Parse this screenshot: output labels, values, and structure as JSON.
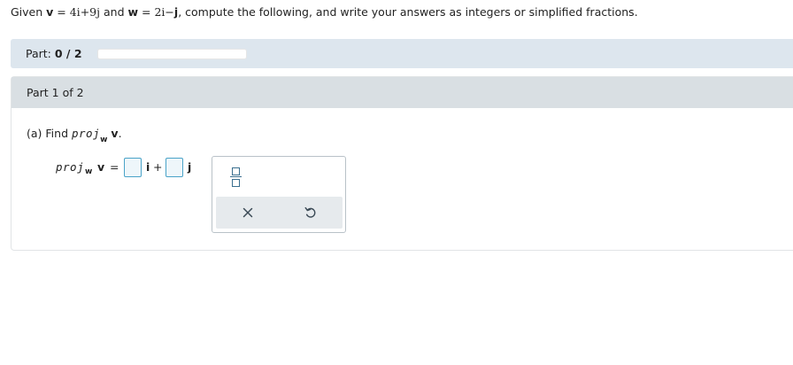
{
  "question": {
    "prefix": "Given ",
    "v_name": "v",
    "eq1": " = ",
    "v_expr_1": "4i",
    "v_plus": "+",
    "v_expr_2": "9j",
    "and": " and ",
    "w_name": "w",
    "eq2": " = ",
    "w_expr_1": "2i",
    "w_minus": "−",
    "w_expr_2": "j",
    "suffix": ", compute the following, and write your answers as integers or simplified fractions."
  },
  "progress": {
    "label": "Part: ",
    "value_text": "0 / 2",
    "fraction_complete": 0
  },
  "part": {
    "header": "Part 1 of 2",
    "prompt_prefix": "(a) Find ",
    "proj": "proj",
    "proj_sub": "w",
    "prompt_v": "v",
    "prompt_end": "."
  },
  "answer": {
    "lhs_proj": "proj",
    "lhs_sub": "w",
    "lhs_v": "v",
    "equals": "=",
    "i_label": "i",
    "plus": "+",
    "j_label": "j",
    "box_i_value": "",
    "box_j_value": ""
  },
  "toolbox": {
    "icons": [
      "fraction-icon",
      "clear-icon",
      "undo-icon"
    ]
  }
}
